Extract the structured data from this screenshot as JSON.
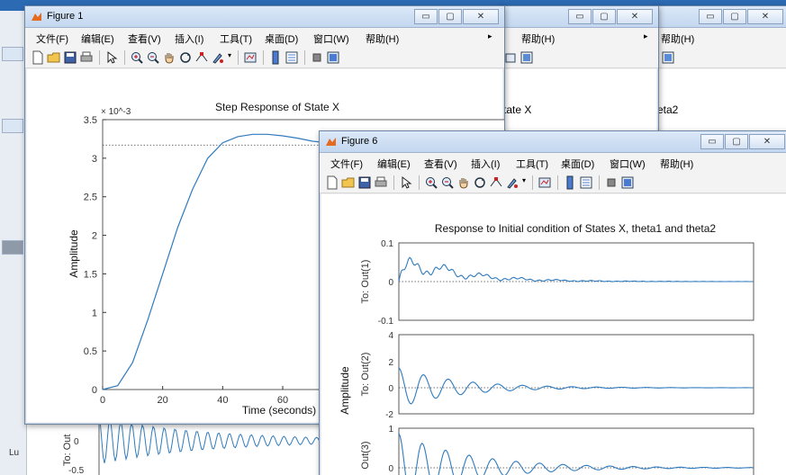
{
  "windows": {
    "figure1": {
      "title": "Figure 1",
      "menu": [
        "文件(F)",
        "编辑(E)",
        "查看(V)",
        "插入(I)",
        "工具(T)",
        "桌面(D)",
        "窗口(W)",
        "帮助(H)"
      ],
      "plot_title": "Step Response of State X",
      "ylabel": "Amplitude",
      "xlabel": "Time (seconds)",
      "y_exponent": "× 10^-3",
      "y_ticks": [
        "0",
        "0.5",
        "1",
        "1.5",
        "2",
        "2.5",
        "3",
        "3.5"
      ],
      "x_ticks": [
        "0",
        "20",
        "40",
        "60"
      ]
    },
    "behind_a": {
      "menu_help": "帮助(H)",
      "plot_title_fragment": "tate X"
    },
    "behind_b": {
      "menu_help": "帮助(H)",
      "plot_title_fragment": "eta2"
    },
    "figure6": {
      "title": "Figure 6",
      "menu": [
        "文件(F)",
        "编辑(E)",
        "查看(V)",
        "插入(I)",
        "工具(T)",
        "桌面(D)",
        "窗口(W)",
        "帮助(H)"
      ],
      "plot_title": "Response to Initial condition of States X, theta1 and theta2",
      "ylabel": "Amplitude",
      "sub1": {
        "label": "To: Out(1)",
        "ticks": [
          "0.1",
          "0",
          "-0.1"
        ]
      },
      "sub2": {
        "label": "To: Out(2)",
        "ticks": [
          "4",
          "2",
          "0",
          "-2"
        ]
      },
      "sub3": {
        "label": "Out(3)",
        "ticks": [
          "1",
          "0"
        ]
      }
    },
    "background_plot": {
      "label": "To: Out",
      "ticks": [
        "0",
        "-0.5"
      ],
      "side_label": "Lu"
    }
  },
  "window_buttons": {
    "minimize": "▭",
    "maximize": "▢",
    "close": "✕"
  },
  "colors": {
    "line": "#2f7bbf",
    "titlebar": "#c4d7ef",
    "frame": "#6f86a5"
  },
  "chart_data": [
    {
      "type": "line",
      "title": "Step Response of State X",
      "xlabel": "Time (seconds)",
      "ylabel": "Amplitude",
      "x_visible": [
        0,
        75
      ],
      "ylim": [
        0,
        0.0035
      ],
      "steady_state": 0.00317,
      "series": [
        {
          "x": [
            0,
            5,
            10,
            15,
            20,
            25,
            30,
            35,
            40,
            45,
            50,
            55,
            60,
            65,
            70,
            75
          ],
          "values": [
            0,
            5e-05,
            0.00035,
            0.0009,
            0.0015,
            0.0021,
            0.0026,
            0.003,
            0.0032,
            0.00328,
            0.00331,
            0.00331,
            0.00329,
            0.00326,
            0.00322,
            0.0032
          ]
        }
      ]
    },
    {
      "type": "line",
      "title": "Response to Initial condition of States X, theta1 and theta2",
      "ylabel": "Amplitude",
      "series": [
        {
          "subplot": "To: Out(1)",
          "ylim": [
            -0.1,
            0.1
          ],
          "description_values": [
            0.1,
            -0.1
          ]
        },
        {
          "subplot": "To: Out(2)",
          "ylim": [
            -2,
            4
          ]
        },
        {
          "subplot": "Out(3)",
          "ylim": [
            -0.2,
            1
          ]
        }
      ]
    }
  ]
}
